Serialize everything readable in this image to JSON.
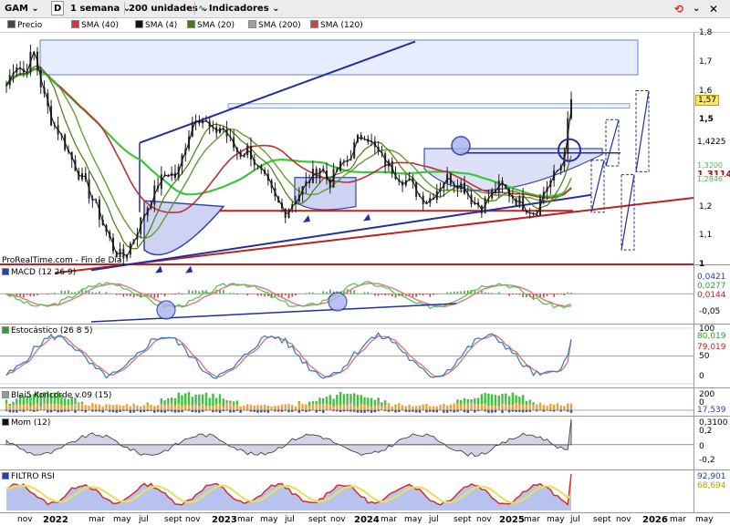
{
  "toolbar": {
    "ticker": "GAM",
    "d_label": "D",
    "period": "1 semana",
    "units": "200 unidades",
    "indicators": "Indicadores",
    "close_glyph": "✕"
  },
  "legend": [
    {
      "label": "Precio",
      "color": "#444444"
    },
    {
      "label": "SMA (40)",
      "color": "#e03030"
    },
    {
      "label": "SMA (4)",
      "color": "#111111"
    },
    {
      "label": "SMA (20)",
      "color": "#4a7a10"
    },
    {
      "label": "SMA (200)",
      "color": "#a0a0a0"
    },
    {
      "label": "SMA (120)",
      "color": "#d04040"
    }
  ],
  "price_panel": {
    "watermark": "ProRealTime.com - Fin de Dia",
    "y_ticks": [
      "1,8",
      "1,7",
      "1,6",
      "1,5",
      "1,4",
      "1,3",
      "1,2",
      "1,1",
      "1"
    ],
    "tags": [
      {
        "text": "1,57",
        "bg": "#f6e56a"
      },
      {
        "text": "1,4225",
        "bg": "#ffffff"
      },
      {
        "text": "1,3114",
        "bg": "#ffffff",
        "color": "#c00000"
      },
      {
        "text": "1,3200",
        "bg": "#ffffff",
        "color": "#30b030"
      },
      {
        "text": "1,2846",
        "bg": "#ffffff",
        "color": "#30b030"
      }
    ]
  },
  "macd_panel": {
    "label": "MACD (12 26 9)",
    "y_ticks": [
      "-0,05"
    ],
    "tags": [
      {
        "text": "0,0421",
        "bg": "#ffffff",
        "color": "#2040c0"
      },
      {
        "text": "0,0277",
        "bg": "#ffffff",
        "color": "#30a030"
      },
      {
        "text": "0,0144",
        "bg": "#ffffff",
        "color": "#c02020"
      }
    ]
  },
  "stoch_panel": {
    "label": "Estocástico (26 8 5)",
    "y_ticks": [
      "100",
      "50",
      "0"
    ],
    "tags": [
      {
        "text": "80,019",
        "bg": "#ffffff",
        "color": "#30a030"
      },
      {
        "text": "79,019",
        "bg": "#ffffff",
        "color": "#c02020"
      }
    ]
  },
  "konc_panel": {
    "label": "Blai5 Koncorde v.09 (15)",
    "y_ticks": [
      "200",
      "0"
    ],
    "tags": [
      {
        "text": "17,539",
        "bg": "#ffffff",
        "color": "#2040c0"
      }
    ]
  },
  "mom_panel": {
    "label": "Mom (12)",
    "y_ticks": [
      "0,3100",
      "0,2",
      "0",
      "-0,2"
    ],
    "tags": []
  },
  "rsi_panel": {
    "label": "FILTRO RSI",
    "tags": [
      {
        "text": "92,901",
        "bg": "#ffffff",
        "color": "#2040c0"
      },
      {
        "text": "68,694",
        "bg": "#ffffff",
        "color": "#c0a000"
      }
    ]
  },
  "x_axis": [
    {
      "t": "nov",
      "yr": false
    },
    {
      "t": "2022",
      "yr": true
    },
    {
      "t": "mar",
      "yr": false
    },
    {
      "t": "may",
      "yr": false
    },
    {
      "t": "jul",
      "yr": false
    },
    {
      "t": "sept",
      "yr": false
    },
    {
      "t": "nov",
      "yr": false
    },
    {
      "t": "2023",
      "yr": true
    },
    {
      "t": "mar",
      "yr": false
    },
    {
      "t": "may",
      "yr": false
    },
    {
      "t": "jul",
      "yr": false
    },
    {
      "t": "sept",
      "yr": false
    },
    {
      "t": "nov",
      "yr": false
    },
    {
      "t": "2024",
      "yr": true
    },
    {
      "t": "mar",
      "yr": false
    },
    {
      "t": "may",
      "yr": false
    },
    {
      "t": "jul",
      "yr": false
    },
    {
      "t": "sept",
      "yr": false
    },
    {
      "t": "nov",
      "yr": false
    },
    {
      "t": "2025",
      "yr": true
    },
    {
      "t": "mar",
      "yr": false
    },
    {
      "t": "may",
      "yr": false
    },
    {
      "t": "jul",
      "yr": false
    },
    {
      "t": "sept",
      "yr": false
    },
    {
      "t": "nov",
      "yr": false
    },
    {
      "t": "2026",
      "yr": true
    },
    {
      "t": "mar",
      "yr": false
    },
    {
      "t": "may",
      "yr": false
    }
  ],
  "chart_data": {
    "type": "line",
    "series": [
      {
        "name": "Precio",
        "values": [
          1.62,
          1.7,
          1.66,
          1.74,
          1.6,
          1.5,
          1.45,
          1.38,
          1.32,
          1.26,
          1.2,
          1.12,
          1.05,
          1.02,
          1.08,
          1.15,
          1.22,
          1.28,
          1.32,
          1.3,
          1.42,
          1.52,
          1.5,
          1.45,
          1.48,
          1.42,
          1.38,
          1.4,
          1.33,
          1.28,
          1.22,
          1.18,
          1.22,
          1.26,
          1.3,
          1.34,
          1.28,
          1.33,
          1.36,
          1.42,
          1.46,
          1.4,
          1.36,
          1.33,
          1.3,
          1.28,
          1.24,
          1.22,
          1.26,
          1.3,
          1.29,
          1.27,
          1.22,
          1.2,
          1.24,
          1.27,
          1.25,
          1.22,
          1.2,
          1.18,
          1.26,
          1.3,
          1.35,
          1.57
        ]
      }
    ],
    "ylim": [
      1.0,
      1.8
    ]
  }
}
